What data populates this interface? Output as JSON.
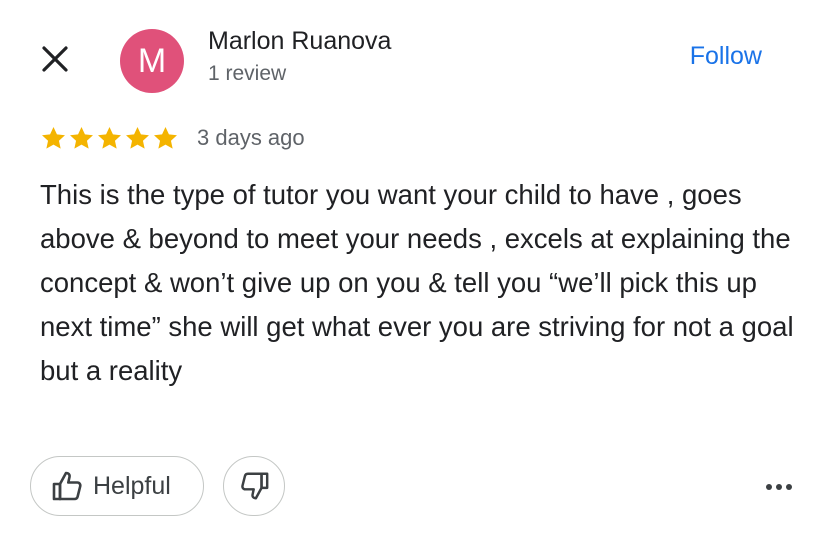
{
  "colors": {
    "avatar_bg": "#e0517a",
    "follow_link": "#1a73e8",
    "star": "#f4b400",
    "text_primary": "#202124",
    "text_secondary": "#5f6368",
    "button_border": "#c4c7c5"
  },
  "header": {
    "close_icon": "close-icon",
    "avatar_initial": "M",
    "author_name": "Marlon Ruanova",
    "review_count": "1 review",
    "follow_label": "Follow"
  },
  "review": {
    "rating": 5,
    "rating_max": 5,
    "date": "3 days ago",
    "text": "This is the type of tutor you want your child to have , goes above & beyond to meet your needs , excels at explaining the concept & won’t give up on you & tell you “we’ll pick this up next time” she will get what ever you are striving for not a goal but a reality"
  },
  "actions": {
    "helpful_label": "Helpful",
    "helpful_icon": "thumbs-up-icon",
    "dislike_icon": "thumbs-down-icon",
    "more_icon": "more-horizontal-icon"
  }
}
